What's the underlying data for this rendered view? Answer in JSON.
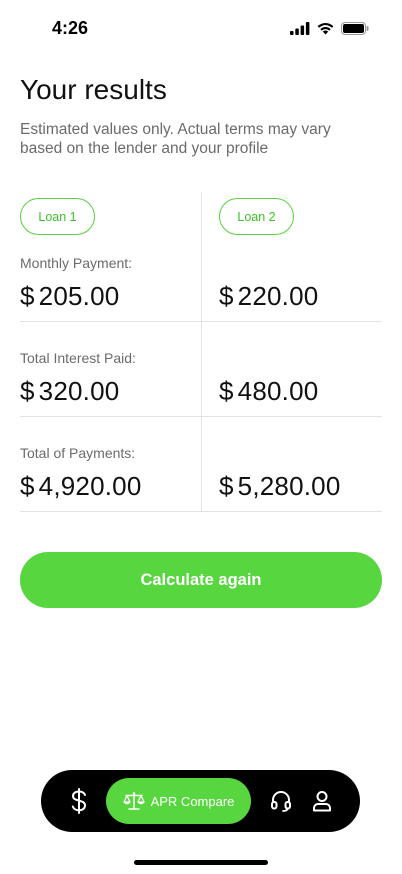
{
  "status_bar": {
    "time": "4:26"
  },
  "header": {
    "title": "Your results",
    "subtitle": "Estimated values only. Actual terms may vary based on the lender and your profile"
  },
  "loans": [
    "Loan 1",
    "Loan 2"
  ],
  "rows": [
    {
      "label": "Monthly Payment:",
      "currency": "$",
      "loan1": "205.00",
      "loan2": "220.00"
    },
    {
      "label": "Total Interest Paid:",
      "currency": "$",
      "loan1": "320.00",
      "loan2": "480.00"
    },
    {
      "label": "Total of Payments:",
      "currency": "$",
      "loan1": "4,920.00",
      "loan2": "5,280.00"
    }
  ],
  "actions": {
    "calculate_again": "Calculate again"
  },
  "bottom_nav": {
    "items": [
      {
        "icon": "dollar-icon",
        "label": ""
      },
      {
        "icon": "scale-icon",
        "label": "APR Compare",
        "active": true
      },
      {
        "icon": "headset-icon",
        "label": ""
      },
      {
        "icon": "user-icon",
        "label": ""
      }
    ]
  },
  "colors": {
    "accent": "#58d63f",
    "text": "#111111",
    "muted": "#6b6b6b",
    "divider": "#e3e3e3"
  }
}
